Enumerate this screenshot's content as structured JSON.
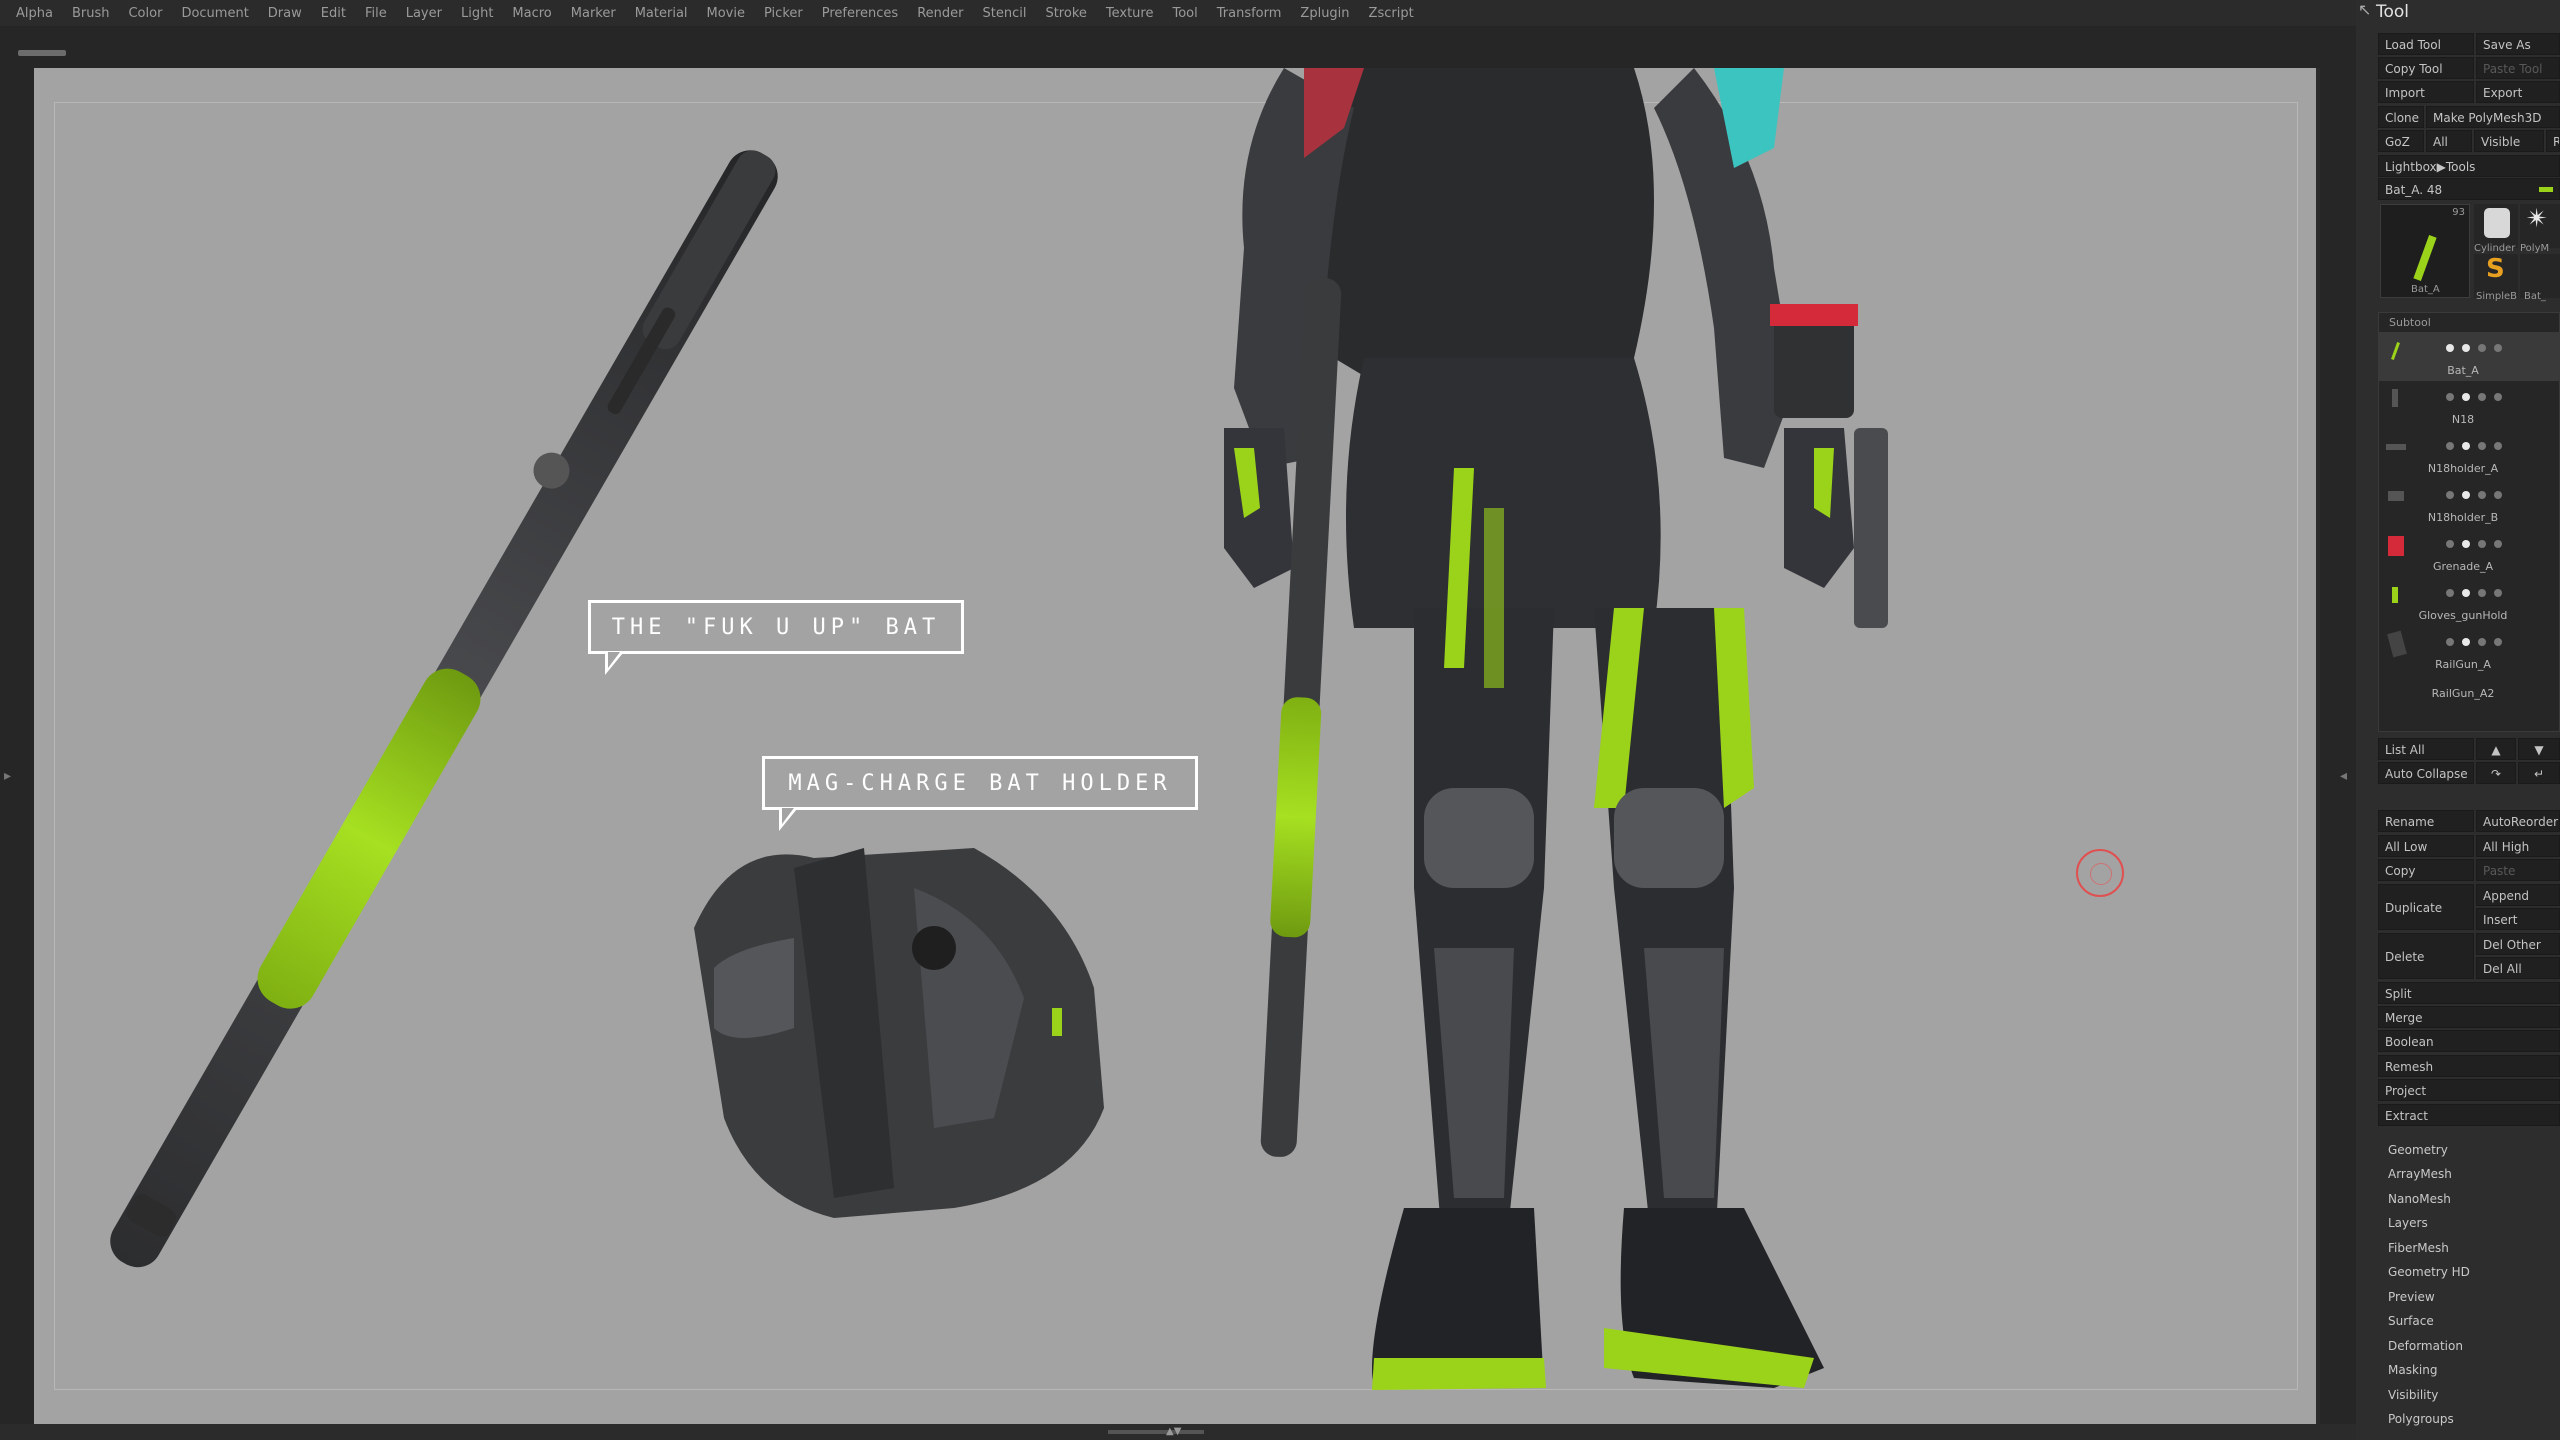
{
  "menu": [
    "Alpha",
    "Brush",
    "Color",
    "Document",
    "Draw",
    "Edit",
    "File",
    "Layer",
    "Light",
    "Macro",
    "Marker",
    "Material",
    "Movie",
    "Picker",
    "Preferences",
    "Render",
    "Stencil",
    "Stroke",
    "Texture",
    "Tool",
    "Transform",
    "Zplugin",
    "Zscript"
  ],
  "callouts": {
    "bat": "THE \"FUK U UP\" BAT",
    "holder": "MAG-CHARGE BAT HOLDER"
  },
  "palette": {
    "title": "Tool",
    "load_tool": "Load Tool",
    "save_as": "Save As",
    "copy_tool": "Copy Tool",
    "paste_tool": "Paste Tool",
    "import": "Import",
    "export": "Export",
    "clone": "Clone",
    "make_polymesh": "Make PolyMesh3D",
    "goz": "GoZ",
    "all": "All",
    "visible": "Visible",
    "r": "R",
    "lightbox_tools": "Lightbox▶Tools",
    "current_tool": "Bat_A. 48",
    "tile_count": "93",
    "tiles": [
      "Bat_A",
      "Cylinder",
      "PolyM",
      "SimpleB",
      "Bat_"
    ],
    "subtool_header": "Subtool",
    "subtools": [
      "Bat_A",
      "N18",
      "N18holder_A",
      "N18holder_B",
      "Grenade_A",
      "Gloves_gunHold",
      "RailGun_A",
      "RailGun_A2"
    ],
    "list_all": "List All",
    "auto_collapse": "Auto Collapse",
    "rename": "Rename",
    "auto_reorder": "AutoReorder",
    "all_low": "All Low",
    "all_high": "All High",
    "copy": "Copy",
    "paste": "Paste",
    "duplicate": "Duplicate",
    "append": "Append",
    "insert": "Insert",
    "delete": "Delete",
    "del_other": "Del Other",
    "del_all": "Del All",
    "actions": [
      "Split",
      "Merge",
      "Boolean",
      "Remesh",
      "Project",
      "Extract"
    ],
    "subpalettes": [
      "Geometry",
      "ArrayMesh",
      "NanoMesh",
      "Layers",
      "FiberMesh",
      "Geometry HD",
      "Preview",
      "Surface",
      "Deformation",
      "Masking",
      "Visibility",
      "Polygroups"
    ]
  },
  "colors": {
    "accent_green": "#9bd21a",
    "canvas": "#a3a3a3",
    "model_dark": "#3a3b3d",
    "red": "#d42a3a"
  }
}
